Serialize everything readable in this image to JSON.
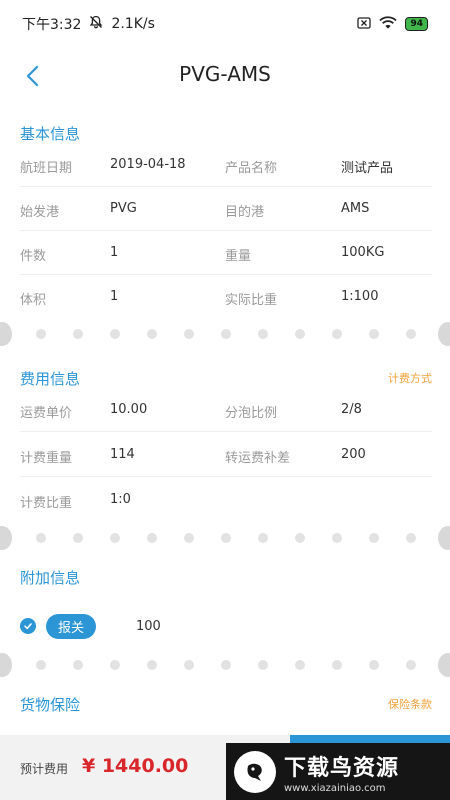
{
  "status_bar": {
    "time": "下午3:32",
    "speed": "2.1K/s",
    "battery": "94"
  },
  "nav": {
    "title": "PVG-AMS"
  },
  "basic": {
    "title": "基本信息",
    "rows": [
      {
        "l1": "航班日期",
        "v1": "2019-04-18",
        "l2": "产品名称",
        "v2": "测试产品"
      },
      {
        "l1": "始发港",
        "v1": "PVG",
        "l2": "目的港",
        "v2": "AMS"
      },
      {
        "l1": "件数",
        "v1": "1",
        "l2": "重量",
        "v2": "100KG"
      },
      {
        "l1": "体积",
        "v1": "1",
        "l2": "实际比重",
        "v2": "1:100"
      }
    ]
  },
  "fee": {
    "title": "费用信息",
    "link": "计费方式",
    "rows": [
      {
        "l1": "运费单价",
        "v1": "10.00",
        "l2": "分泡比例",
        "v2": "2/8"
      },
      {
        "l1": "计费重量",
        "v1": "114",
        "l2": "转运费补差",
        "v2": "200"
      },
      {
        "l1": "计费比重",
        "v1": "1:0"
      }
    ]
  },
  "extra": {
    "title": "附加信息",
    "item_label": "报关",
    "item_value": "100"
  },
  "insurance": {
    "title": "货物保险",
    "link": "保险条款"
  },
  "bottom": {
    "est_label": "预计费用",
    "est_value": "¥ 1440.00"
  },
  "watermark": {
    "name": "下载鸟资源",
    "url": "www.xiazainiao.com"
  },
  "colors": {
    "accent": "#2b95d6",
    "link": "#f2a13a",
    "price": "#d8262a"
  }
}
